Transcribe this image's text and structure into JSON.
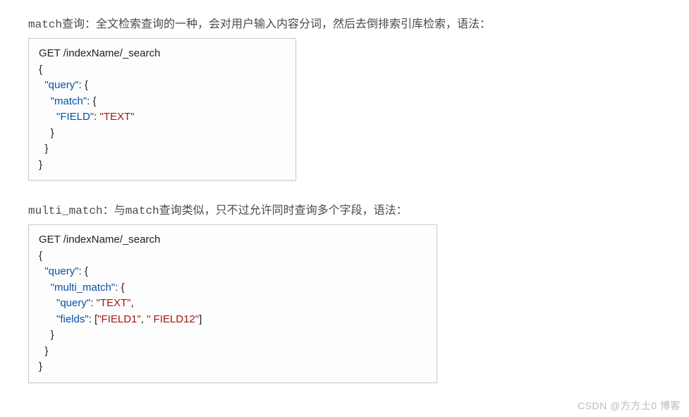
{
  "section1": {
    "desc_prefix_mono": "match",
    "desc_rest": "查询：全文检索查询的一种，会对用户输入内容分词，然后去倒排索引库检索，语法：",
    "code": {
      "line1": "GET /indexName/_search",
      "line2": "{",
      "line3_indent": "  ",
      "line3_key": "\"query\"",
      "line3_after": ": {",
      "line4_indent": "    ",
      "line4_key": "\"match\"",
      "line4_after": ": {",
      "line5_indent": "      ",
      "line5_key": "\"FIELD\"",
      "line5_colon": ": ",
      "line5_val": "\"TEXT\"",
      "line6": "    }",
      "line7": "  }",
      "line8": "}"
    }
  },
  "section2": {
    "desc_prefix_mono": "multi_match",
    "desc_mid1": "：与",
    "desc_mono2": "match",
    "desc_rest": "查询类似，只不过允许同时查询多个字段，语法：",
    "code": {
      "line1": "GET /indexName/_search",
      "line2": "{",
      "line3_indent": "  ",
      "line3_key": "\"query\"",
      "line3_after": ": {",
      "line4_indent": "    ",
      "line4_key": "\"multi_match\"",
      "line4_after": ": {",
      "line5_indent": "      ",
      "line5_key": "\"query\"",
      "line5_colon": ": ",
      "line5_val": "\"TEXT\"",
      "line5_comma": ",",
      "line6_indent": "      ",
      "line6_key": "\"fields\"",
      "line6_colon": ": [",
      "line6_val1": "\"FIELD1\"",
      "line6_sep": ", ",
      "line6_val2": "\" FIELD12\"",
      "line6_close": "]",
      "line7": "    }",
      "line8": "  }",
      "line9": "}"
    }
  },
  "watermark": "CSDN @方方土0 博客"
}
